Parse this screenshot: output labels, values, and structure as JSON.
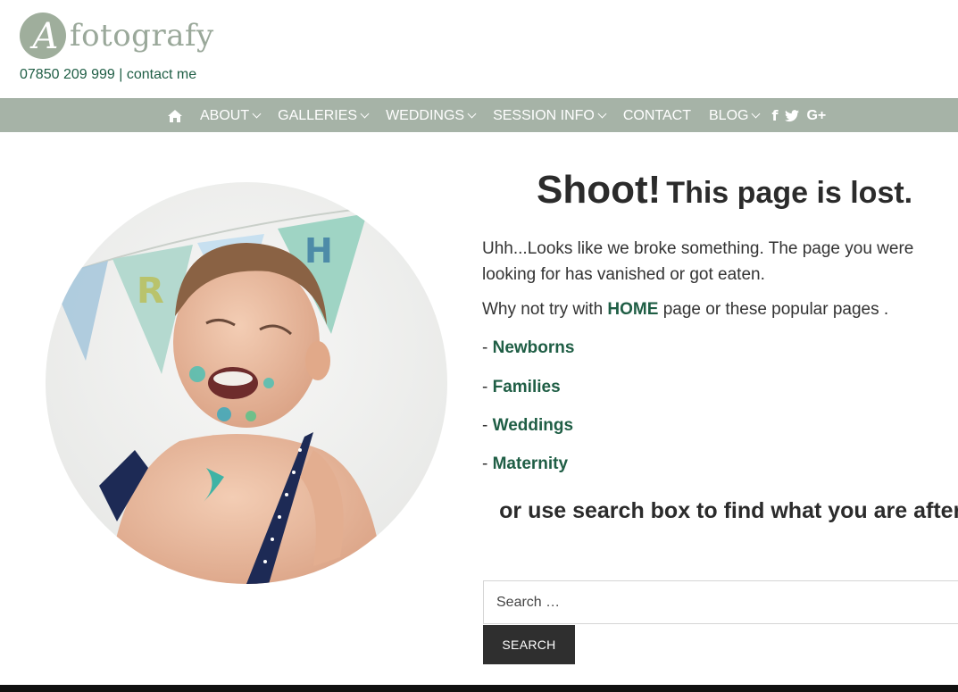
{
  "header": {
    "logo_letter": "A",
    "logo_text": "fotografy",
    "phone": "07850 209 999",
    "separator": " | ",
    "contact_link": "contact me"
  },
  "nav": {
    "home_icon": "home-icon",
    "items": [
      {
        "label": "ABOUT",
        "dropdown": true
      },
      {
        "label": "GALLERIES",
        "dropdown": true
      },
      {
        "label": "WEDDINGS",
        "dropdown": true
      },
      {
        "label": "SESSION INFO",
        "dropdown": true
      },
      {
        "label": "CONTACT",
        "dropdown": false
      },
      {
        "label": "BLOG",
        "dropdown": true
      }
    ],
    "social": [
      "f",
      "twitter-icon",
      "G+"
    ]
  },
  "main": {
    "title_big": "Shoot!",
    "title_small": "This page is lost.",
    "intro": "Uhh...Looks like we broke something. The page you were looking for has vanished or got eaten.",
    "try_prefix": "Why not try with ",
    "home_link": "HOME",
    "try_suffix": " page or these popular pages .",
    "popular_prefix": "- ",
    "popular": [
      "Newborns",
      "Families",
      "Weddings",
      "Maternity"
    ],
    "search_prompt": "or use search box to find what you are after.",
    "search_placeholder": "Search …",
    "search_button": "SEARCH"
  },
  "colors": {
    "nav_bg": "#a6b3a7",
    "link_green": "#1f5e45",
    "logo_grey": "#9aa89a",
    "button_dark": "#2f2f2f"
  }
}
